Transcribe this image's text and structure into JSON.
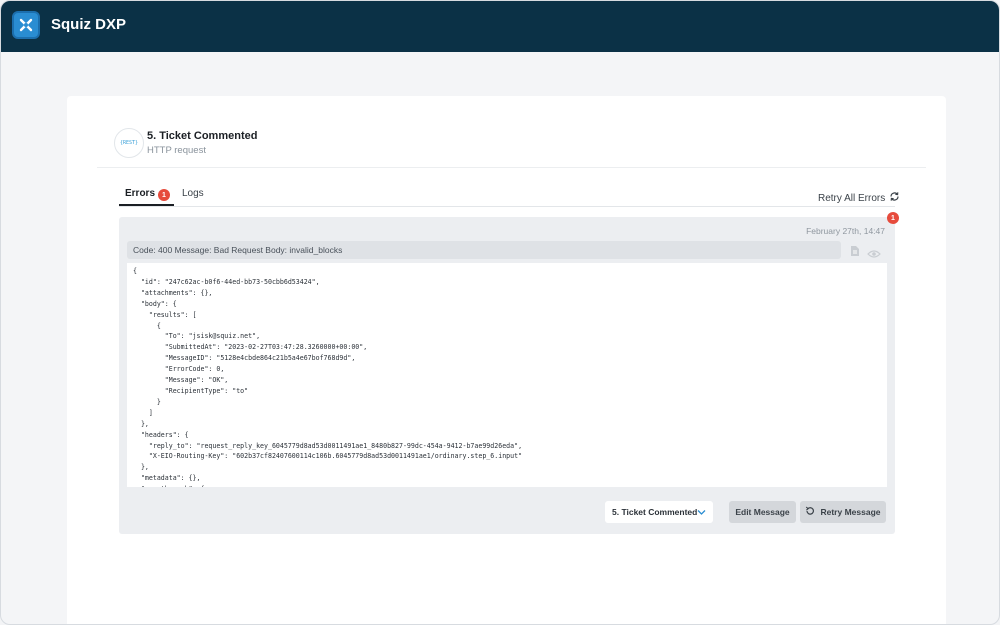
{
  "app": {
    "name": "Squiz DXP"
  },
  "step": {
    "badge_text": "{REST}",
    "title": "5. Ticket Commented",
    "subtitle": "HTTP request"
  },
  "tabs": [
    {
      "label": "Errors",
      "count": "1"
    },
    {
      "label": "Logs"
    }
  ],
  "retry_all_label": "Retry All Errors",
  "error": {
    "count": "1",
    "timestamp": "February 27th, 14:47",
    "message": "Code: 400 Message: Bad Request Body: invalid_blocks",
    "body_lines": "{\n  \"id\": \"247c62ac-b0f6-44ed-bb73-50cbb6d53424\",\n  \"attachments\": {},\n  \"body\": {\n    \"results\": [\n      {\n        \"To\": \"jsisk@squiz.net\",\n        \"SubmittedAt\": \"2023-02-27T03:47:28.3260000+00:00\",\n        \"MessageID\": \"5128e4cbde864c21b5a4e67bof768d9d\",\n        \"ErrorCode\": 0,\n        \"Message\": \"OK\",\n        \"RecipientType\": \"to\"\n      }\n    ]\n  },\n  \"headers\": {\n    \"reply_to\": \"request_reply_key_6045779d8ad53d0011491ae1_8480b827-99dc-454a-9412-b7ae99d26eda\",\n    \"X-EIO-Routing-Key\": \"602b37cf82407600114c106b.6045779d8ad53d0011491ae1/ordinary.step_6.input\"\n  },\n  \"metadata\": {},\n  \"passthrough\": {"
  },
  "actions": {
    "step_select": "5. Ticket Commented",
    "edit_label": "Edit Message",
    "retry_label": "Retry Message"
  },
  "colors": {
    "topbar": "#0b3146",
    "accent": "#2a8dd2",
    "badge": "#e64b3c"
  }
}
